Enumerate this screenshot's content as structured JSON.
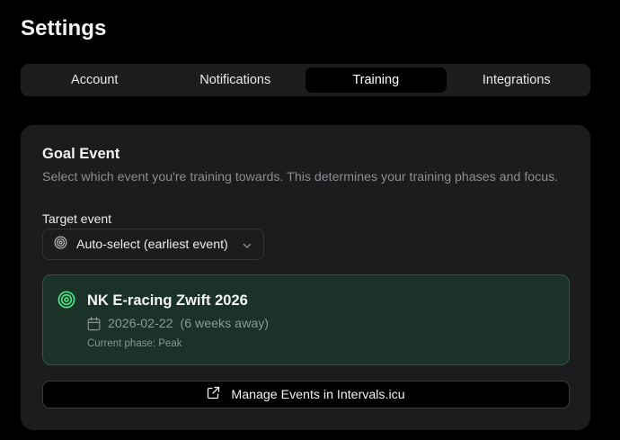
{
  "page": {
    "title": "Settings"
  },
  "tabs": [
    {
      "label": "Account",
      "active": false
    },
    {
      "label": "Notifications",
      "active": false
    },
    {
      "label": "Training",
      "active": true
    },
    {
      "label": "Integrations",
      "active": false
    }
  ],
  "goal_event": {
    "title": "Goal Event",
    "description": "Select which event you're training towards. This determines your training phases and focus.",
    "target_label": "Target event",
    "select": {
      "value": "Auto-select (earliest event)",
      "icon": "target-icon"
    },
    "event": {
      "name": "NK E-racing Zwift 2026",
      "date": "2026-02-22",
      "away": "(6 weeks away)",
      "phase": "Current phase: Peak",
      "accent_color": "#4ade80"
    },
    "manage_button": {
      "label": "Manage Events in Intervals.icu",
      "icon": "external-link-icon"
    }
  }
}
